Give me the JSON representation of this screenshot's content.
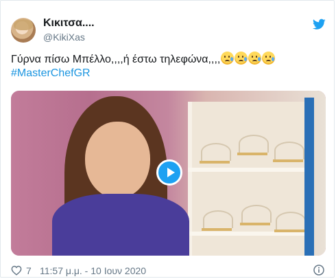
{
  "author": {
    "display_name": "Κικιτσα....",
    "handle": "@KikiXas"
  },
  "tweet": {
    "text": "Γύρνα πίσω Μπέλλο,,,,ή έστω τηλεφώνα,,,,",
    "emoji_names": [
      "sad-but-relieved-face",
      "sad-but-relieved-face",
      "sad-but-relieved-face",
      "sad-but-relieved-face"
    ],
    "hashtag": "#MasterChefGR"
  },
  "footer": {
    "like_count": "7",
    "timestamp": "11:57 μ.μ. - 10 Ιουν 2020"
  },
  "icons": {
    "brand": "twitter-bird-icon",
    "play": "play-icon",
    "heart": "heart-icon",
    "info": "info-icon"
  },
  "colors": {
    "accent": "#1da1f2",
    "link": "#1b95e0",
    "muted": "#657786"
  }
}
